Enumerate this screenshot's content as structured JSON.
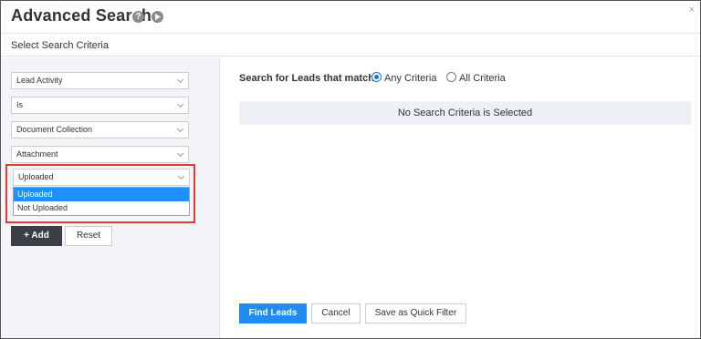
{
  "dialog": {
    "title": "Advanced Search",
    "help_icon": "question-circle-icon",
    "play_icon": "play-circle-icon",
    "close_glyph": "×",
    "subtitle": "Select Search Criteria"
  },
  "criteria": {
    "field_1": "Lead Activity",
    "operator": "Is",
    "field_2": "Document Collection",
    "field_3": "Attachment",
    "value_select": "Uploaded",
    "value_options": [
      "Uploaded",
      "Not Uploaded"
    ],
    "selected_option": "Uploaded",
    "add_label": "+ Add",
    "reset_label": "Reset"
  },
  "results": {
    "match_label": "Search for Leads that match",
    "any_label": "Any Criteria",
    "all_label": "All Criteria",
    "selected_mode": "Any Criteria",
    "empty_message": "No Search Criteria is Selected",
    "find_label": "Find Leads",
    "cancel_label": "Cancel",
    "quick_filter_label": "Save as Quick Filter"
  },
  "colors": {
    "primary": "#1e8cf0",
    "highlight": "#e53935",
    "dark_button": "#3b3f45",
    "panel_bg": "#f2f4f8"
  }
}
